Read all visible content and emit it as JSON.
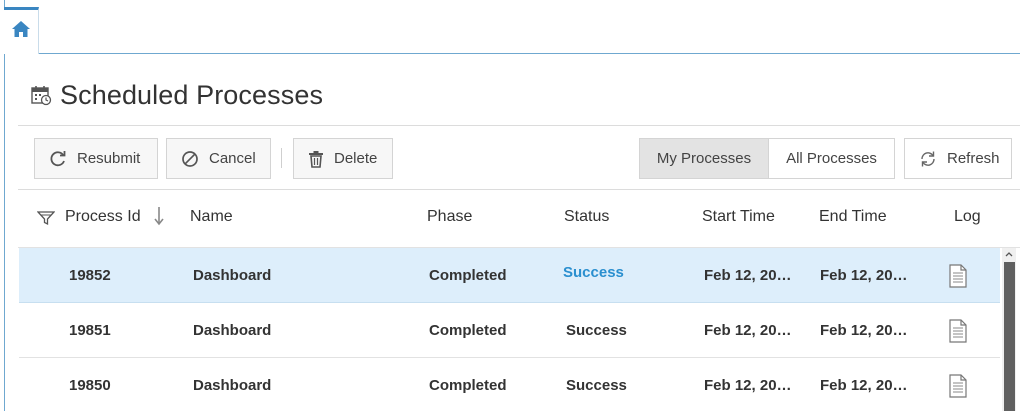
{
  "page": {
    "title": "Scheduled Processes"
  },
  "toolbar": {
    "resubmit_label": "Resubmit",
    "cancel_label": "Cancel",
    "delete_label": "Delete",
    "my_processes_label": "My Processes",
    "all_processes_label": "All Processes",
    "refresh_label": "Refresh",
    "active_segment": "My Processes"
  },
  "table": {
    "columns": {
      "process_id": "Process Id",
      "name": "Name",
      "phase": "Phase",
      "status": "Status",
      "start_time": "Start Time",
      "end_time": "End Time",
      "log": "Log"
    },
    "sort": {
      "column": "Process Id",
      "direction": "descending"
    },
    "rows": [
      {
        "process_id": "19852",
        "name": "Dashboard",
        "phase": "Completed",
        "status": "Success",
        "start_time": "Feb 12, 20…",
        "end_time": "Feb 12, 20…",
        "selected": true
      },
      {
        "process_id": "19851",
        "name": "Dashboard",
        "phase": "Completed",
        "status": "Success",
        "start_time": "Feb 12, 20…",
        "end_time": "Feb 12, 20…",
        "selected": false
      },
      {
        "process_id": "19850",
        "name": "Dashboard",
        "phase": "Completed",
        "status": "Success",
        "start_time": "Feb 12, 20…",
        "end_time": "Feb 12, 20…",
        "selected": false
      }
    ]
  },
  "icons": {
    "home": "home-icon",
    "title": "calendar-icon",
    "resubmit": "resubmit-icon",
    "cancel": "cancel-icon",
    "delete": "trash-icon",
    "refresh": "refresh-icon",
    "filter": "filter-icon",
    "sort": "sort-down-arrow-icon",
    "log": "log-document-icon"
  },
  "colors": {
    "accent": "#3a86c1",
    "link": "#2a8fcf",
    "selected_row": "#ddeefb",
    "active_segment": "#e3e3e3"
  }
}
